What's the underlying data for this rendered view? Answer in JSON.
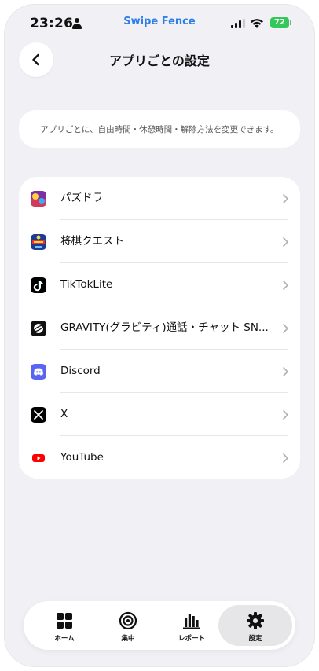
{
  "status_bar": {
    "time": "23:26",
    "app_brand": "Swipe Fence",
    "battery": "72",
    "brand_color": "#2f7fe8",
    "battery_color": "#34c759"
  },
  "header": {
    "title": "アプリごとの設定",
    "back_icon": "chevron-left-icon"
  },
  "info": {
    "text": "アプリごとに、自由時間・休憩時間・解除方法を変更できます。"
  },
  "apps": [
    {
      "label": "パズドラ",
      "icon": "puzzle-dragons-icon"
    },
    {
      "label": "将棋クエスト",
      "icon": "shogi-quest-icon"
    },
    {
      "label": "TikTokLite",
      "icon": "tiktok-icon"
    },
    {
      "label": "GRAVITY(グラビティ)通話・チャット SN...",
      "icon": "gravity-icon"
    },
    {
      "label": "Discord",
      "icon": "discord-icon"
    },
    {
      "label": "X",
      "icon": "x-icon"
    },
    {
      "label": "YouTube",
      "icon": "youtube-icon"
    }
  ],
  "tabs": [
    {
      "label": "ホーム",
      "icon": "grid-icon",
      "active": false
    },
    {
      "label": "集中",
      "icon": "target-icon",
      "active": false
    },
    {
      "label": "レポート",
      "icon": "bar-chart-icon",
      "active": false
    },
    {
      "label": "設定",
      "icon": "gear-icon",
      "active": true
    }
  ]
}
